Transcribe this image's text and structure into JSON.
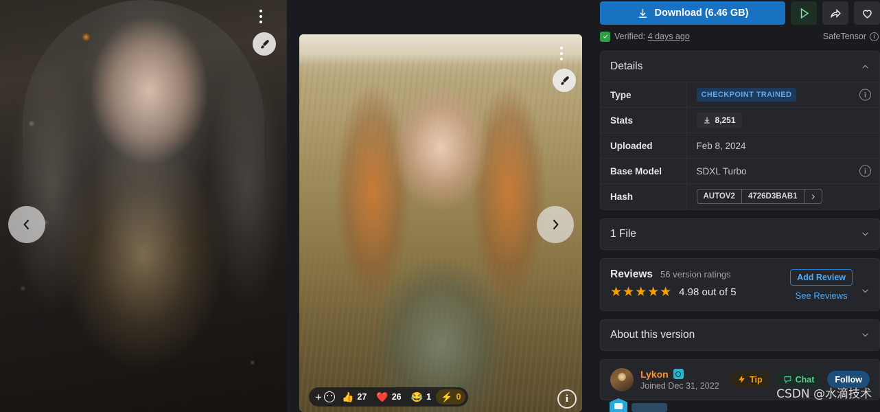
{
  "gallery": {
    "prev_label": "Previous image",
    "next_label": "Next image",
    "menu_label": "More options",
    "remix_label": "Remix",
    "info_label": "i",
    "reactions": [
      {
        "emoji": "👍",
        "count": "27",
        "name": "thumbs-up",
        "active": false
      },
      {
        "emoji": "❤️",
        "count": "26",
        "name": "heart",
        "active": false
      },
      {
        "emoji": "😂",
        "count": "1",
        "name": "laugh",
        "active": false
      },
      {
        "emoji": "⚡",
        "count": "0",
        "name": "bolt",
        "active": true
      }
    ]
  },
  "actions": {
    "download_label": "Download (6.46 GB)",
    "run_label": "Run model",
    "share_label": "Share",
    "favorite_label": "Favorite",
    "accent_blue": "#1971c2"
  },
  "verification": {
    "prefix": "Verified:",
    "time": "4 days ago",
    "format": "SafeTensor",
    "info": "i",
    "shield_color": "#2f9e44"
  },
  "details": {
    "title": "Details",
    "rows": [
      {
        "key": "Type",
        "value": "CHECKPOINT TRAINED",
        "kind": "badge",
        "info": "i"
      },
      {
        "key": "Stats",
        "value": "8,251",
        "kind": "chip",
        "info": ""
      },
      {
        "key": "Uploaded",
        "value": "Feb 8, 2024",
        "kind": "text",
        "info": ""
      },
      {
        "key": "Base Model",
        "value": "SDXL Turbo",
        "kind": "text",
        "info": "i"
      },
      {
        "key": "Hash",
        "value": "4726D3BAB1",
        "kind": "hash",
        "algo": "AUTOV2",
        "info": ""
      }
    ]
  },
  "files": {
    "title": "1 File"
  },
  "reviews": {
    "title": "Reviews",
    "ratings_count": "56 version ratings",
    "stars": "★★★★★",
    "score": "4.98 out of 5",
    "add_label": "Add Review",
    "see_label": "See Reviews"
  },
  "about": {
    "title": "About this version"
  },
  "creator": {
    "name": "Lykon",
    "joined": "Joined Dec 31, 2022",
    "tip_label": "Tip",
    "chat_label": "Chat",
    "follow_label": "Follow"
  },
  "watermark": {
    "text": "CSDN @水滴技术"
  }
}
